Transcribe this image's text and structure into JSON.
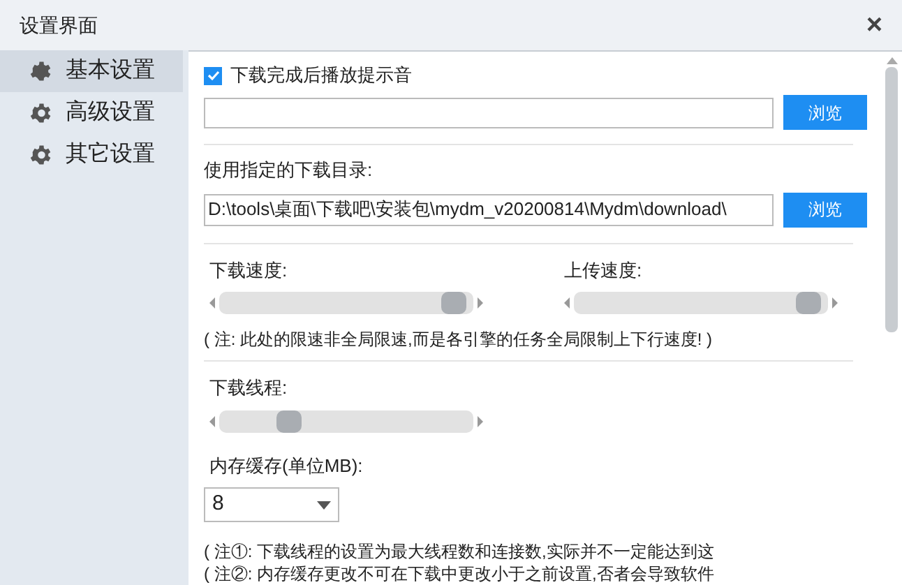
{
  "window": {
    "title": "设置界面",
    "close": "×"
  },
  "sidebar": {
    "items": [
      {
        "label": "基本设置",
        "selected": true
      },
      {
        "label": "高级设置",
        "selected": false
      },
      {
        "label": "其它设置",
        "selected": false
      }
    ]
  },
  "sound": {
    "label": "下载完成后播放提示音",
    "checked": true,
    "browse": "浏览"
  },
  "directory": {
    "label": "使用指定的下载目录:",
    "value": "D:\\tools\\桌面\\下载吧\\安装包\\mydm_v20200814\\Mydm\\download\\",
    "browse": "浏览"
  },
  "speed": [
    {
      "label": "下载速度:",
      "level": 0.97
    },
    {
      "label": "上传速度:",
      "level": 0.97
    }
  ],
  "speed_note": "( 注: 此处的限速非全局限速,而是各引擎的任务全局限制上下行速度! )",
  "threads": {
    "label": "下载线程:",
    "level": 0.25
  },
  "cache": {
    "label": "内存缓存(单位MB):",
    "value": "8"
  },
  "notes": [
    "( 注①: 下载线程的设置为最大线程数和连接数,实际并不一定能达到这",
    "( 注②: 内存缓存更改不可在下载中更改小于之前设置,否者会导致软件"
  ]
}
